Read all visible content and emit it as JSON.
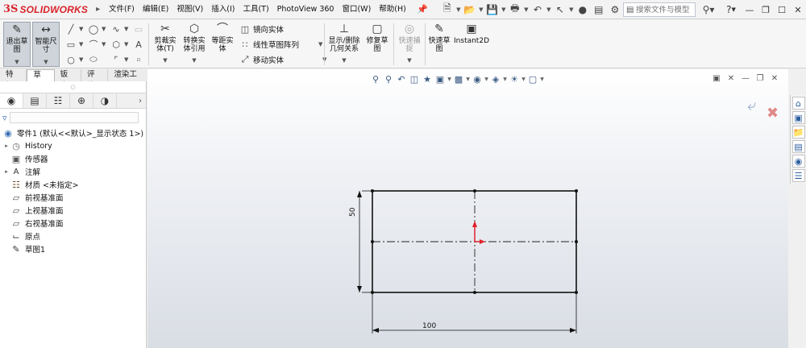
{
  "app": {
    "logo_prefix": "3S",
    "logo_name": "SOLIDWORKS",
    "menus": [
      "文件(F)",
      "编辑(E)",
      "视图(V)",
      "插入(I)",
      "工具(T)",
      "PhotoView 360",
      "窗口(W)",
      "帮助(H)"
    ],
    "search_placeholder": "搜索文件与模型",
    "help_label": "?"
  },
  "ribbon": {
    "exit_sketch": "退出草\n图",
    "smart_dimension": "智能尺\n寸",
    "trim_entities": "剪裁实\n体(T)",
    "convert_entities": "转换实\n体引用",
    "offset_entities": "等距实\n体",
    "mirror_entities": "镜向实体",
    "linear_pattern": "线性草图阵列",
    "move_entities": "移动实体",
    "display_relations": "显示/删除\n几何关系",
    "repair_sketch": "修复草\n图",
    "quick_snaps": "快速捕\n捉",
    "rapid_sketch": "快速草\n图",
    "instant2d": "Instant2D"
  },
  "command_tabs": [
    {
      "label": "特征",
      "active": false
    },
    {
      "label": "草图",
      "active": true
    },
    {
      "label": "钣金",
      "active": false
    },
    {
      "label": "评估",
      "active": false
    },
    {
      "label": "渲染工具",
      "active": false
    }
  ],
  "feature_tree": {
    "root": "零件1 (默认<<默认>_显示状态 1>)",
    "items": [
      {
        "label": "History",
        "expandable": true
      },
      {
        "label": "传感器",
        "expandable": false
      },
      {
        "label": "注解",
        "expandable": true
      },
      {
        "label": "材质 <未指定>",
        "expandable": false
      },
      {
        "label": "前视基准面",
        "expandable": false
      },
      {
        "label": "上视基准面",
        "expandable": false
      },
      {
        "label": "右视基准面",
        "expandable": false
      },
      {
        "label": "原点",
        "expandable": false
      },
      {
        "label": "草图1",
        "expandable": false
      }
    ]
  },
  "sketch": {
    "dim_width": "100",
    "dim_height": "50"
  },
  "colors": {
    "brand": "#d8232a",
    "origin": "#e0202a",
    "sketch_line": "#111111"
  }
}
